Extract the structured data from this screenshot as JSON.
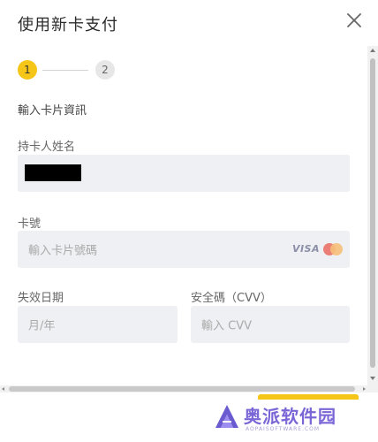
{
  "modal": {
    "title": "使用新卡支付",
    "close_icon": "close-icon"
  },
  "steps": {
    "current": 1,
    "items": [
      {
        "label": "1",
        "state": "active",
        "color": "#f5c518"
      },
      {
        "label": "2",
        "state": "inactive",
        "color": "#e7e7e7"
      }
    ]
  },
  "form": {
    "section_title": "輸入卡片資訊",
    "holder": {
      "label": "持卡人姓名",
      "value": "",
      "redacted": true
    },
    "card_number": {
      "label": "卡號",
      "placeholder": "輸入卡片號碼",
      "brand_visa": "VISA",
      "brand_icons": [
        "visa-logo",
        "mastercard-icon"
      ]
    },
    "expiry": {
      "label": "失效日期",
      "placeholder": "月/年"
    },
    "cvv": {
      "label": "安全碼（CVV）",
      "placeholder": "輸入 CVV"
    }
  },
  "footer": {
    "next_button_color": "#f5c518"
  },
  "watermark": {
    "text": "奥派软件园",
    "subtext": "AOPAISOFTWARE.COM"
  },
  "colors": {
    "accent": "#f5c518",
    "field_bg": "#eef0f3",
    "watermark": "#7a66d6"
  }
}
